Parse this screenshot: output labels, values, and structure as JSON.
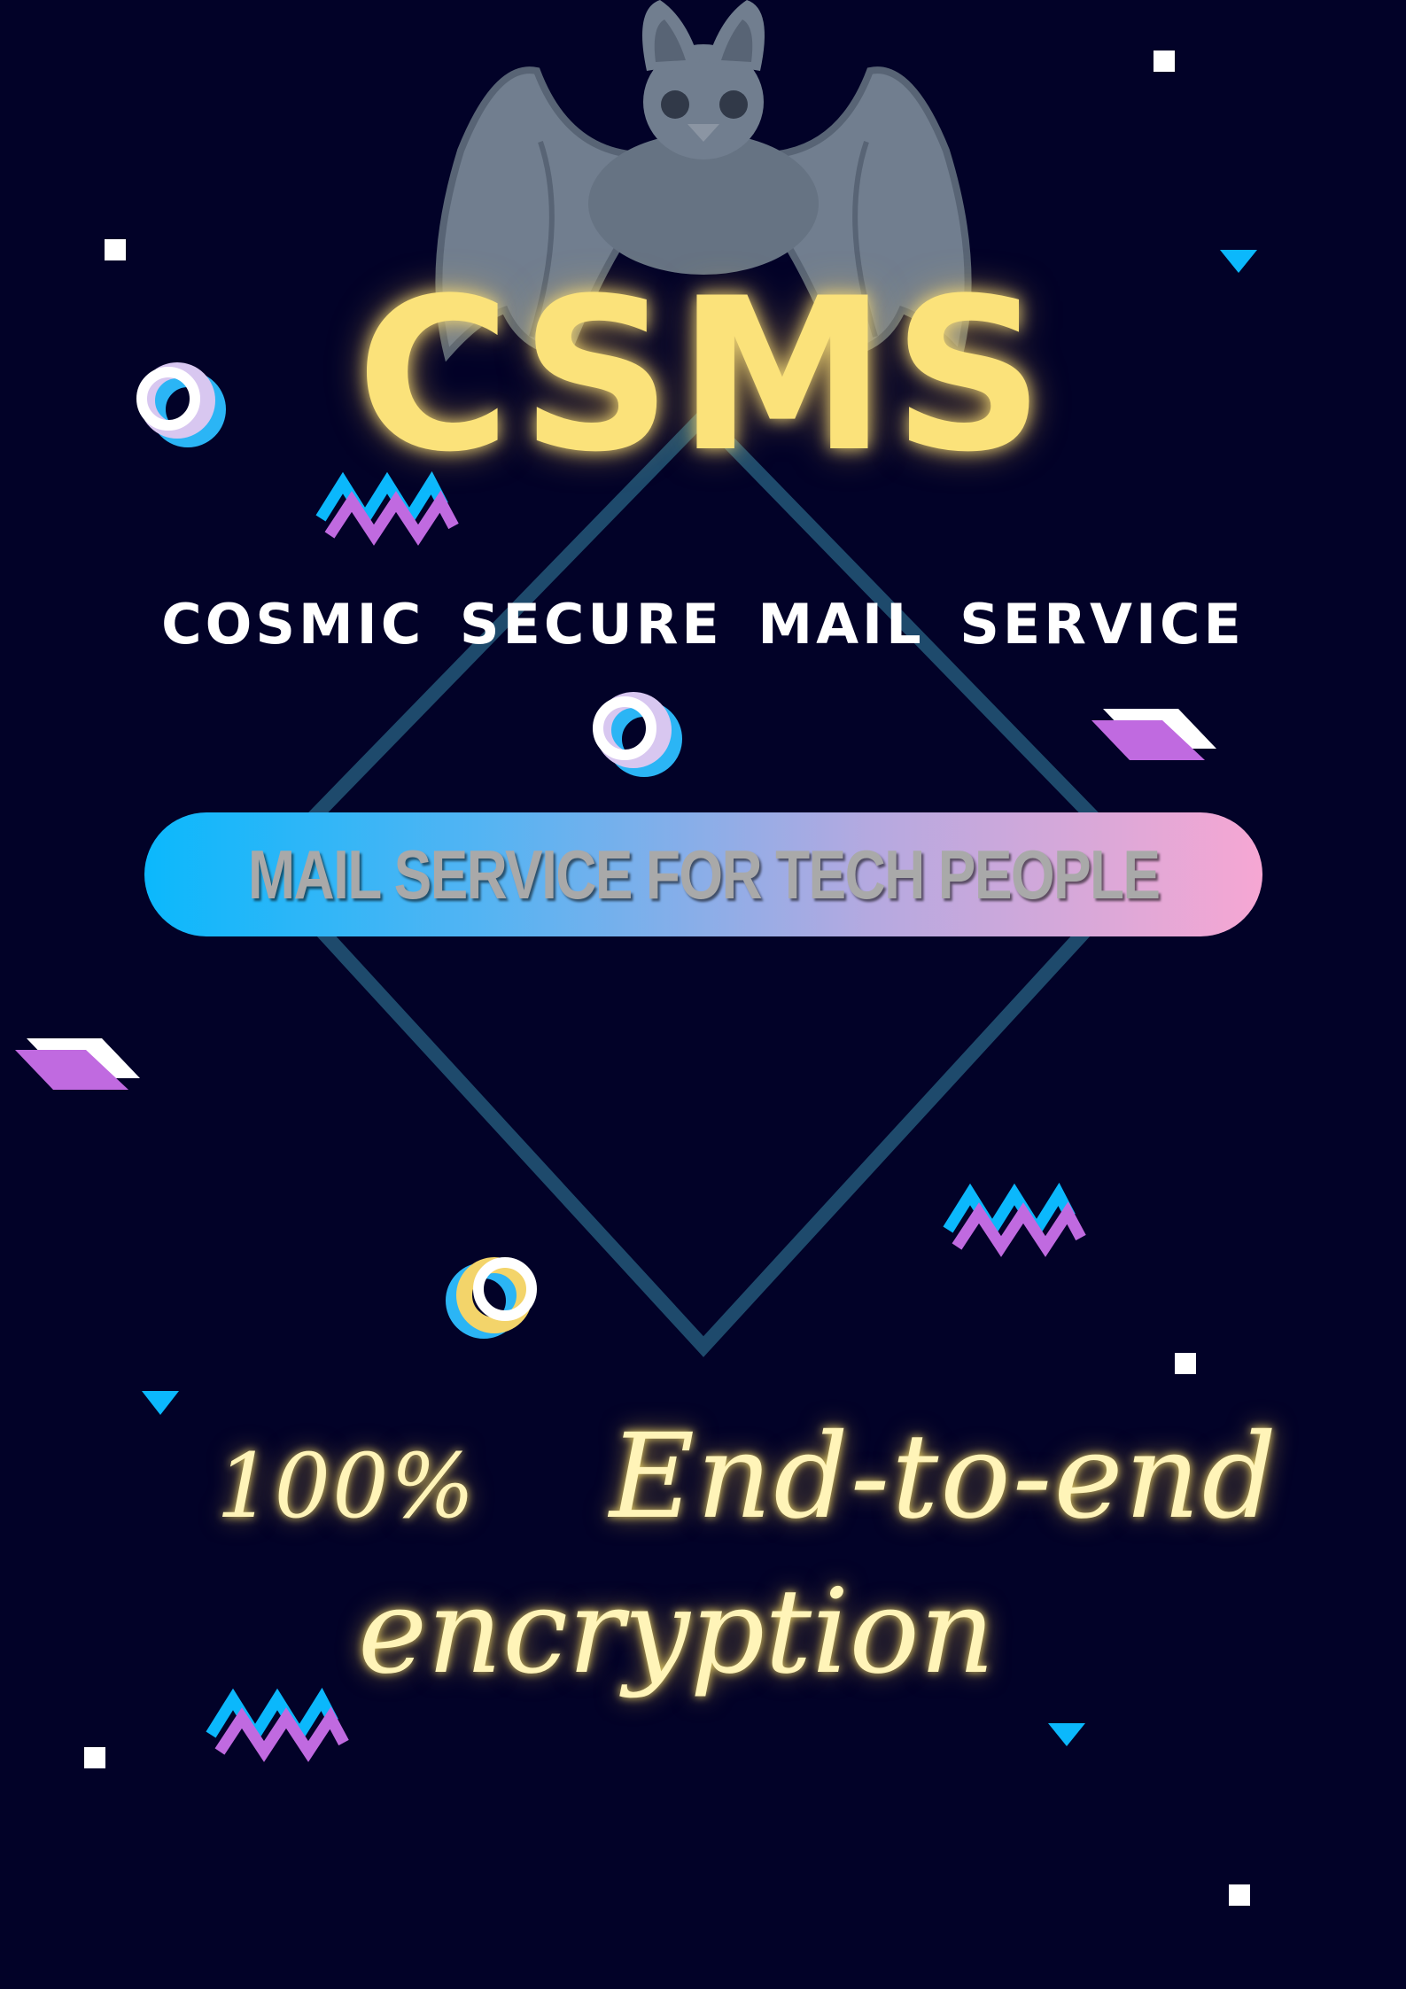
{
  "logo": {
    "title": "CSMS",
    "mascot_icon": "bat-icon"
  },
  "subtitle": "COSMIC SECURE MAIL SERVICE",
  "banner": {
    "label": "MAIL SERVICE FOR TECH PEOPLE"
  },
  "tagline": {
    "percent": "100%",
    "line1": "End-to-end",
    "line2": "encryption"
  },
  "colors": {
    "background": "#020228",
    "logo_yellow": "#fbe27a",
    "diamond_outline": "#1e4a6c",
    "accent_blue": "#0bb8fc",
    "accent_purple": "#c06ae0",
    "accent_pink": "#f6a7d3"
  }
}
